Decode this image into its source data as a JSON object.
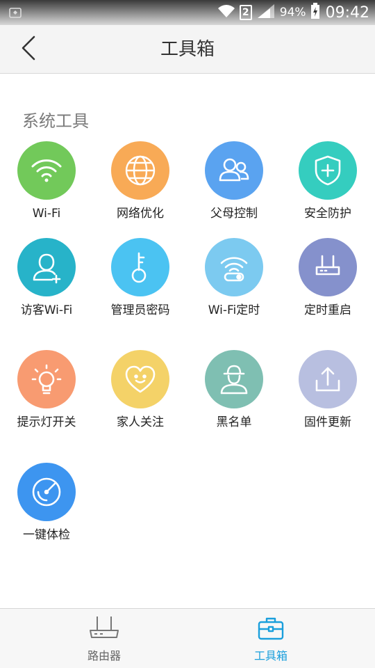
{
  "status_bar": {
    "sim_slot": "2",
    "battery": "94%",
    "time": "09:42"
  },
  "header": {
    "title": "工具箱",
    "back_icon": "chevron-left-icon"
  },
  "section": {
    "title": "系统工具"
  },
  "tools": [
    {
      "id": "wifi",
      "label": "Wi-Fi",
      "color": "#72c95a",
      "icon": "wifi-icon"
    },
    {
      "id": "network-optimize",
      "label": "网络优化",
      "color": "#f8aa56",
      "icon": "globe-icon"
    },
    {
      "id": "parental-control",
      "label": "父母控制",
      "color": "#5aa3f0",
      "icon": "parent-child-icon"
    },
    {
      "id": "security",
      "label": "安全防护",
      "color": "#35cdbf",
      "icon": "shield-icon"
    },
    {
      "id": "guest-wifi",
      "label": "访客Wi-Fi",
      "color": "#27b3c9",
      "icon": "guest-user-icon"
    },
    {
      "id": "admin-password",
      "label": "管理员密码",
      "color": "#4bc3f2",
      "icon": "key-icon"
    },
    {
      "id": "wifi-timer",
      "label": "Wi-Fi定时",
      "color": "#7ccaf0",
      "icon": "wifi-timer-icon"
    },
    {
      "id": "timed-reboot",
      "label": "定时重启",
      "color": "#8591cc",
      "icon": "router-icon"
    },
    {
      "id": "indicator-light",
      "label": "提示灯开关",
      "color": "#f89b71",
      "icon": "lightbulb-icon"
    },
    {
      "id": "family-watch",
      "label": "家人关注",
      "color": "#f4d268",
      "icon": "heart-icon"
    },
    {
      "id": "blacklist",
      "label": "黑名单",
      "color": "#7fbfb2",
      "icon": "spy-user-icon"
    },
    {
      "id": "firmware-update",
      "label": "固件更新",
      "color": "#b8bfe0",
      "icon": "upload-icon"
    },
    {
      "id": "health-check",
      "label": "一键体检",
      "color": "#3d95f0",
      "icon": "radar-icon"
    }
  ],
  "tabbar": {
    "router_label": "路由器",
    "toolbox_label": "工具箱",
    "active_color": "#1a9fdc",
    "inactive_color": "#666666"
  }
}
